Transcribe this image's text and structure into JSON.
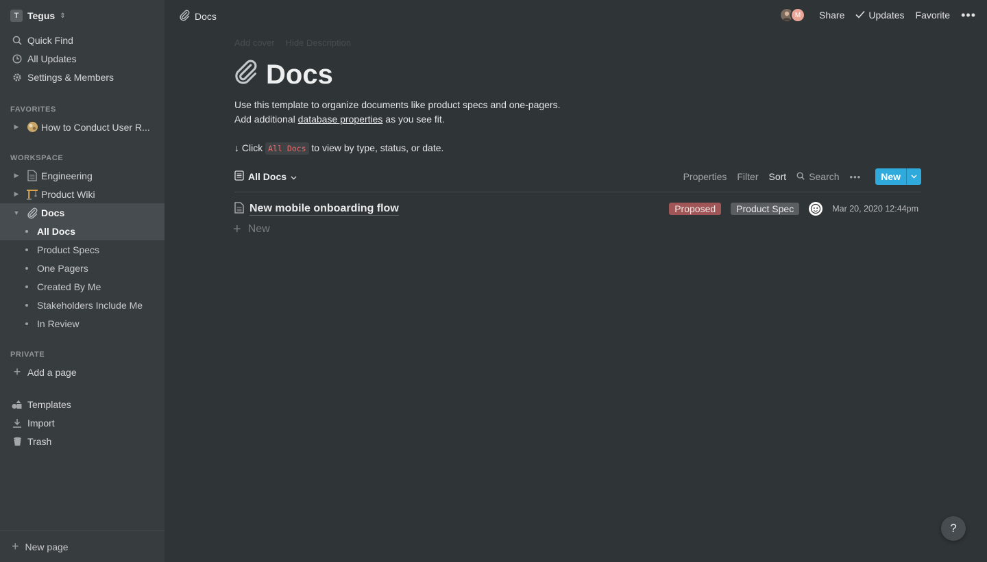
{
  "workspace": {
    "initial": "T",
    "name": "Tegus"
  },
  "sidebar": {
    "top": [
      {
        "label": "Quick Find",
        "icon": "search-icon"
      },
      {
        "label": "All Updates",
        "icon": "clock-icon"
      },
      {
        "label": "Settings & Members",
        "icon": "gear-icon"
      }
    ],
    "favorites_label": "FAVORITES",
    "favorites": [
      {
        "label": "How to Conduct User R...",
        "icon": "globe-emoji-icon"
      }
    ],
    "workspace_label": "WORKSPACE",
    "workspace_pages": [
      {
        "label": "Engineering",
        "icon": "document-icon"
      },
      {
        "label": "Product Wiki",
        "icon": "construction-crane-icon"
      },
      {
        "label": "Docs",
        "icon": "paperclip-icon"
      }
    ],
    "docs_views": [
      "All Docs",
      "Product Specs",
      "One Pagers",
      "Created By Me",
      "Stakeholders Include Me",
      "In Review"
    ],
    "private_label": "PRIVATE",
    "add_page": "Add a page",
    "bottom": [
      {
        "label": "Templates",
        "icon": "templates-icon"
      },
      {
        "label": "Import",
        "icon": "download-icon"
      },
      {
        "label": "Trash",
        "icon": "trash-icon"
      }
    ],
    "new_page": "New page"
  },
  "topbar": {
    "breadcrumb": "Docs",
    "avatar_initial": "M",
    "share": "Share",
    "updates": "Updates",
    "favorite": "Favorite"
  },
  "page": {
    "add_cover": "Add cover",
    "hide_description": "Hide Description",
    "title": "Docs",
    "desc_line1": "Use this template to organize documents like product specs and one-pagers.",
    "desc_line2_pre": "Add additional ",
    "desc_line2_link": "database properties",
    "desc_line2_post": " as you see fit.",
    "hint_pre": "↓ Click ",
    "hint_code": "All Docs",
    "hint_post": " to view by type, status, or date."
  },
  "view": {
    "name": "All Docs",
    "properties": "Properties",
    "filter": "Filter",
    "sort": "Sort",
    "search": "Search",
    "new": "New"
  },
  "rows": [
    {
      "title": "New mobile onboarding flow",
      "status": "Proposed",
      "type": "Product Spec",
      "date": "Mar 20, 2020 12:44pm"
    }
  ],
  "add_row": "New",
  "help": "?",
  "colors": {
    "accent": "#2eaadc",
    "status_proposed": "#a05656",
    "type_tag": "#5a5e61",
    "code_text": "#eb6b6b"
  }
}
